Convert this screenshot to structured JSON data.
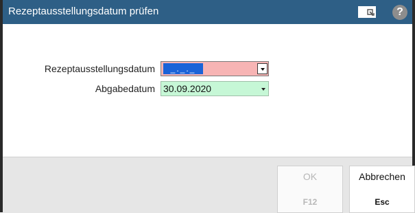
{
  "window": {
    "title": "Rezeptausstellungsdatum prüfen",
    "help_glyph": "?",
    "icons": [
      "window-icon",
      "help-icon"
    ]
  },
  "form": {
    "rezept_label": "Rezeptausstellungsdatum",
    "rezept_value": "_._._",
    "abgabe_label": "Abgabedatum",
    "abgabe_value": "30.09.2020"
  },
  "buttons": {
    "ok_label": "OK",
    "ok_key": "F12",
    "cancel_label": "Abbrechen",
    "cancel_key": "Esc"
  },
  "colors": {
    "titlebar": "#2e5f86",
    "invalid_field": "#f7b4b4",
    "valid_field": "#c6f7d6",
    "selection": "#1a63d8",
    "footer": "#e6e6e6"
  }
}
